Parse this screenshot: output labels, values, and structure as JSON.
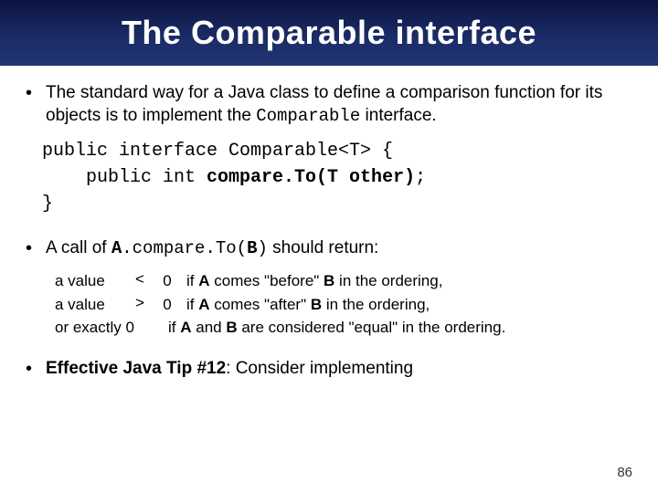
{
  "title": "The Comparable interface",
  "bullets": {
    "b1_pre": "The standard way for a Java class to define a comparison function for its objects is to implement the ",
    "b1_code": "Comparable",
    "b1_post": " interface."
  },
  "code": {
    "l1": "public interface Comparable<T> {",
    "l2_pre": "    public int ",
    "l2_bold": "compare.To(T other)",
    "l2_post": ";",
    "l3": "}"
  },
  "call": {
    "pre": "A call of  ",
    "A": "A",
    "dot": ".",
    "method_pre": "compare.To(",
    "B": "B",
    "method_post": ")",
    "post": "  should return:"
  },
  "rules": {
    "r1_c1": "a value",
    "r1_c2": "<",
    "r1_c3": "0",
    "r1_c4_pre": "if ",
    "r1_c4_A": "A",
    "r1_c4_mid": " comes \"before\" ",
    "r1_c4_B": "B",
    "r1_c4_post": " in the ordering,",
    "r2_c1": "a value",
    "r2_c2": ">",
    "r2_c3": "0",
    "r2_c4_pre": "if ",
    "r2_c4_A": "A",
    "r2_c4_mid": " comes \"after\" ",
    "r2_c4_B": "B",
    "r2_c4_post": " in the ordering,",
    "r3_c1": "or exactly 0",
    "r3_c4_pre": "if ",
    "r3_c4_A": "A",
    "r3_c4_mid": " and ",
    "r3_c4_B": "B",
    "r3_c4_post": " are considered \"equal\" in the ordering."
  },
  "tip": {
    "bold": "Effective Java Tip #12",
    "rest": ": Consider implementing"
  },
  "page_number": "86",
  "dot": "•"
}
